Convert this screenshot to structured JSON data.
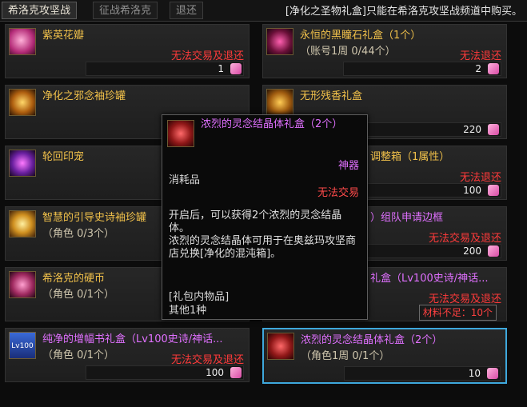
{
  "tabs": [
    "希洛克攻坚战",
    "征战希洛克",
    "退还"
  ],
  "notice": "[净化之圣物礼盒]只能在希洛克攻坚战频道中购买。",
  "cards": [
    {
      "name": "紫英花瓣",
      "sub": "",
      "status": "无法交易及退还",
      "price": "1"
    },
    {
      "name": "永恒的黑瞳石礼盒（1个）",
      "sub": "（账号1周 0/44个）",
      "status": "无法退还",
      "price": "2"
    },
    {
      "name": "净化之邪念袖珍罐",
      "sub": "",
      "status": "",
      "price": ""
    },
    {
      "name": "无形残香礼盒",
      "sub": "",
      "status": "",
      "price": "220"
    },
    {
      "name": "轮回印宠",
      "sub": "",
      "status": "",
      "price": ""
    },
    {
      "name": "调整箱（1属性）",
      "sub": "",
      "status": "无法退还",
      "price": "100"
    },
    {
      "name": "智慧的引导史诗袖珍罐",
      "sub": "（角色 0/3个）",
      "status": "",
      "price": ""
    },
    {
      "name": "）组队申请边框",
      "sub": "",
      "status": "无法交易及退还",
      "price": "200"
    },
    {
      "name": "希洛克的硬币",
      "sub": "（角色 0/1个）",
      "status": "",
      "price": ""
    },
    {
      "name": "礼盒（Lv100史诗/神话...",
      "sub": "",
      "status": "无法交易及退还",
      "price": "",
      "material": "材料不足：10个"
    },
    {
      "name": "纯净的增幅书礼盒（Lv100史诗/神话...",
      "sub": "（角色 0/1个）",
      "status": "无法交易及退还",
      "price": "100",
      "icon_label": "Lv100"
    },
    {
      "name": "浓烈的灵念结晶体礼盒（2个）",
      "sub": "（角色1周 0/1个）",
      "status": "",
      "price": "10"
    }
  ],
  "tooltip": {
    "title": "浓烈的灵念结晶体礼盒（2个）",
    "rarity": "神器",
    "type": "消耗品",
    "trade": "无法交易",
    "desc1": "开启后，可以获得2个浓烈的灵念结晶体。",
    "desc2": "浓烈的灵念结晶体可用于在奥兹玛攻坚商店兑换[净化的混沌箱]。",
    "contents_header": "[礼包内物品]",
    "contents": "其他1种"
  }
}
